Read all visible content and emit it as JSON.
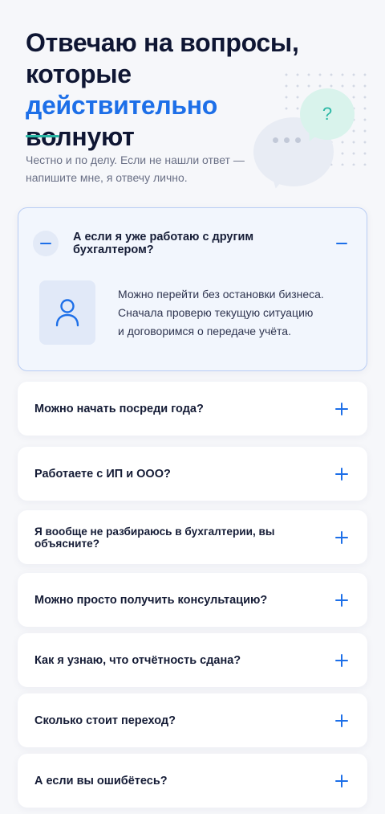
{
  "header": {
    "title_line1": "Отвечаю на вопросы,",
    "title_line2": "которые",
    "title_accent": "действительно",
    "title_end": "волнуют",
    "subtitle_line1": "Честно и по делу. Если не нашли ответ —",
    "subtitle_line2": "напишите мне, я отвечу лично.",
    "bubble_symbol": "?"
  },
  "colors": {
    "accent": "#1d6fe8",
    "divider": "#2ab8a5",
    "background": "#f6f7fa"
  },
  "faq": {
    "open": {
      "question": "А если я уже работаю с другим бухгалтером?",
      "answer_line1": "Можно перейти без остановки бизнеса.",
      "answer_line2": "Сначала проверю текущую ситуацию",
      "answer_line3": "и договоримся о передаче учёта.",
      "icon": "user-icon"
    },
    "items": [
      {
        "question": "Можно начать посреди года?"
      },
      {
        "question": "Работаете с ИП и ООО?"
      },
      {
        "question": "Я вообще не разбираюсь в бухгалтерии, вы объясните?"
      },
      {
        "question": "Можно просто получить консультацию?"
      },
      {
        "question": "Как я узнаю, что отчётность сдана?"
      },
      {
        "question": "Сколько стоит переход?"
      },
      {
        "question": "А если вы ошибётесь?"
      }
    ]
  }
}
